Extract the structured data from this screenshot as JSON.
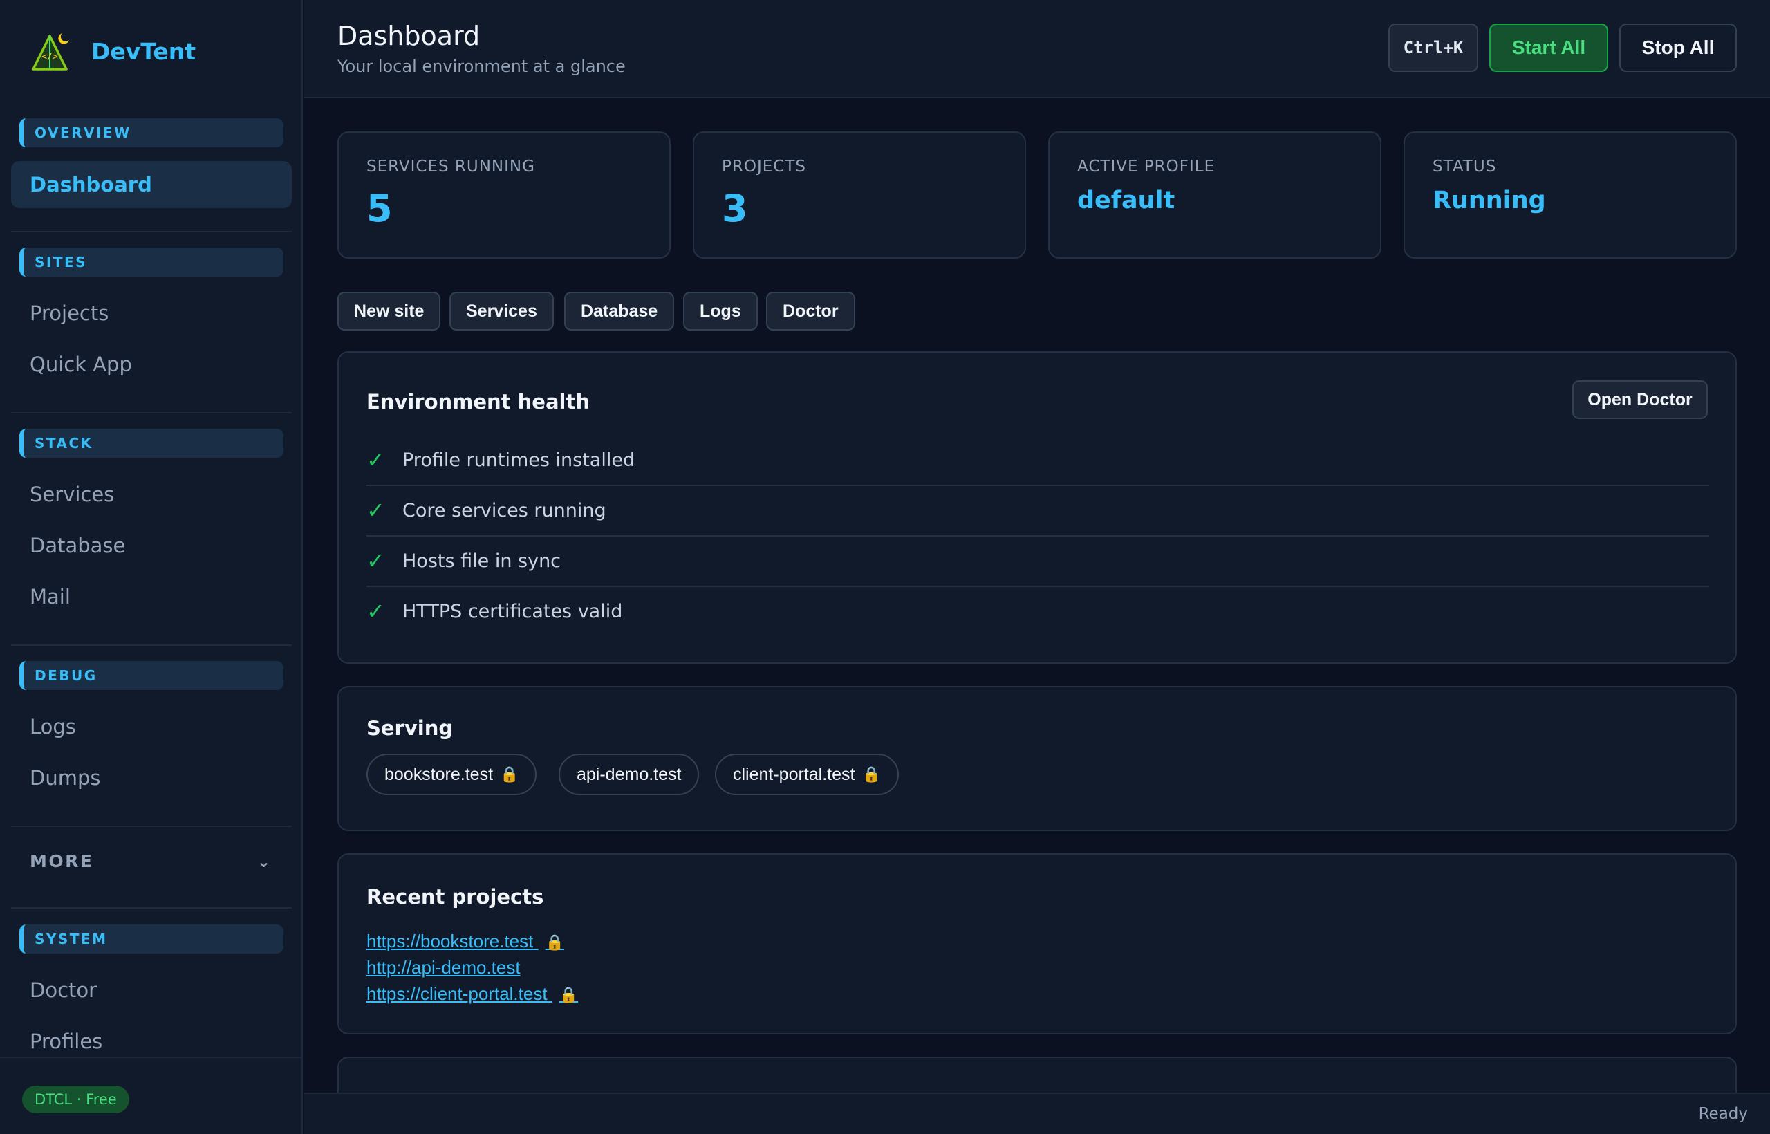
{
  "app": {
    "name": "DevTent"
  },
  "sidebar": {
    "sections": [
      {
        "label": "OVERVIEW",
        "items": [
          "Dashboard"
        ]
      },
      {
        "label": "SITES",
        "items": [
          "Projects",
          "Quick App"
        ]
      },
      {
        "label": "STACK",
        "items": [
          "Services",
          "Database",
          "Mail"
        ]
      },
      {
        "label": "DEBUG",
        "items": [
          "Logs",
          "Dumps"
        ]
      },
      {
        "label": "SYSTEM",
        "items": [
          "Doctor",
          "Profiles"
        ]
      }
    ],
    "more_label": "MORE",
    "plan_badge": "DTCL · Free"
  },
  "header": {
    "title": "Dashboard",
    "subtitle": "Your local environment at a glance",
    "shortcut": "Ctrl+K",
    "start_all": "Start All",
    "stop_all": "Stop All"
  },
  "stats": [
    {
      "label": "SERVICES RUNNING",
      "value": "5"
    },
    {
      "label": "PROJECTS",
      "value": "3"
    },
    {
      "label": "ACTIVE PROFILE",
      "value": "default"
    },
    {
      "label": "STATUS",
      "value": "Running"
    }
  ],
  "quick_actions": [
    "New site",
    "Services",
    "Database",
    "Logs",
    "Doctor"
  ],
  "health": {
    "title": "Environment health",
    "open_button": "Open Doctor",
    "checks": [
      "Profile runtimes installed",
      "Core services running",
      "Hosts file in sync",
      "HTTPS certificates valid"
    ]
  },
  "serving": {
    "title": "Serving",
    "sites": [
      {
        "host": "bookstore.test",
        "secure": true
      },
      {
        "host": "api-demo.test",
        "secure": false
      },
      {
        "host": "client-portal.test",
        "secure": true
      }
    ]
  },
  "recent": {
    "title": "Recent projects",
    "links": [
      {
        "url": "https://bookstore.test",
        "secure": true
      },
      {
        "url": "http://api-demo.test",
        "secure": false
      },
      {
        "url": "https://client-portal.test",
        "secure": true
      }
    ]
  },
  "status_bar": {
    "text": "Ready"
  },
  "colors": {
    "accent": "#38bdf8",
    "success": "#22c55e",
    "background": "#0b1120",
    "panel": "#111a2b"
  }
}
